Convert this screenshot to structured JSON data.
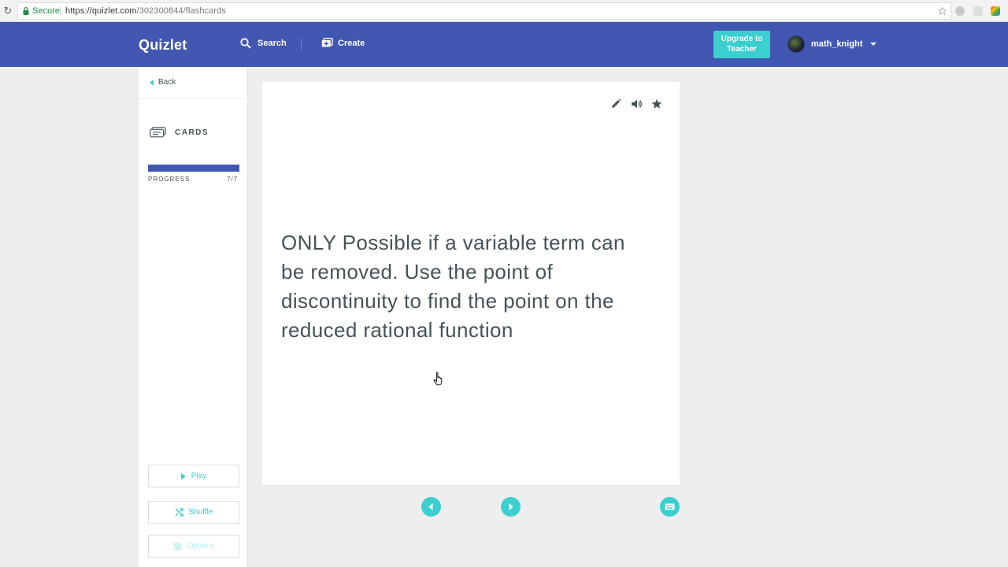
{
  "browser": {
    "secure_label": "Secure",
    "url_host": "https://quizlet.com",
    "url_path": "/302300844/flashcards"
  },
  "header": {
    "logo": "Quizlet",
    "search_label": "Search",
    "create_label": "Create",
    "upgrade_line1": "Upgrade to",
    "upgrade_line2": "Teacher",
    "username": "math_knight"
  },
  "sidebar": {
    "back_label": "Back",
    "mode_label": "CARDS",
    "progress_label": "PROGRESS",
    "progress_count": "7/7",
    "progress_fraction": 1.0,
    "play_label": "Play",
    "shuffle_label": "Shuffle",
    "options_label": "Options"
  },
  "card": {
    "text": "ONLY Possible if a variable term can be removed. Use the point of discontinuity to find the point on the reduced rational function"
  },
  "colors": {
    "brand": "#4257b2",
    "accent": "#3ccfcf",
    "text": "#455358"
  },
  "icons": {
    "edit": "pencil-icon",
    "audio": "speaker-icon",
    "favorite": "star-icon",
    "prev": "arrow-left-icon",
    "next": "arrow-right-icon",
    "keyboard": "keyboard-icon"
  }
}
